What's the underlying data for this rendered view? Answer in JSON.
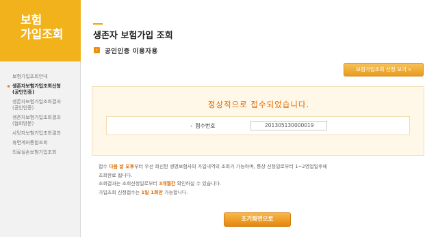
{
  "sidebar": {
    "title_line1": "보험",
    "title_line2": "가입조회",
    "items": [
      {
        "line1": "보험가입조회안내",
        "line2": ""
      },
      {
        "line1": "생존자보험가입조회신청",
        "line2": "(공인인증)"
      },
      {
        "line1": "생존자보험가입조회결과",
        "line2": "(공인인증)"
      },
      {
        "line1": "생존자보험가입조회결과",
        "line2": "(협회방문)"
      },
      {
        "line1": "사망자보험가입조회결과",
        "line2": ""
      },
      {
        "line1": "휴면계좌통합조회",
        "line2": ""
      },
      {
        "line1": "의료실손보험가입조회",
        "line2": ""
      }
    ],
    "active_index": 1
  },
  "main": {
    "page_title": "생존자 보험가입 조회",
    "sub_title": "공인인증 이용자용",
    "view_button": "보험가입조회 신청 보기 »",
    "result_message": "정상적으로 접수되었습니다.",
    "receipt_label": "접수번호",
    "receipt_number": "201305130000019",
    "notes": {
      "line1_pre": "접수 ",
      "line1_hl": "다음 날 오후",
      "line1_post": "부터 우선 회신된 생명보험사의 가입내역의 조회가 가능하며, 통상 신청일로부터 1~2영업일후에",
      "line2": "조회완료 됩니다.",
      "line3_pre": "조회결과는 조회신청일로부터 ",
      "line3_hl": "3개월간",
      "line3_post": " 확인하실 수 있습니다.",
      "line4_pre": "가입조회 신청접수는 ",
      "line4_hl": "1일 1회만",
      "line4_post": " 가능합니다."
    },
    "home_button": "초기화면으로"
  },
  "colors": {
    "accent": "#f2b21b",
    "highlight": "#e06a00"
  }
}
